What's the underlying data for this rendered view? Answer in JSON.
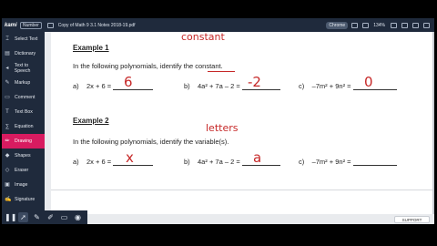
{
  "topbar": {
    "logo": "kami",
    "badge": "Number",
    "file_name": "Copy of Math 9 3.1 Notes 2018-19.pdf",
    "pill1": "Chrome",
    "zoom": "134%"
  },
  "sidebar": {
    "items": [
      {
        "label": "Select Text",
        "icon": "cursor-text-icon",
        "glyph": "⌶"
      },
      {
        "label": "Dictionary",
        "icon": "book-icon",
        "glyph": "▤"
      },
      {
        "label": "Text to Speech",
        "icon": "speaker-icon",
        "glyph": "◂"
      },
      {
        "label": "Markup",
        "icon": "highlighter-icon",
        "glyph": "✎"
      },
      {
        "label": "Comment",
        "icon": "comment-icon",
        "glyph": "▭"
      },
      {
        "label": "Text Box",
        "icon": "textbox-icon",
        "glyph": "T"
      },
      {
        "label": "Equation",
        "icon": "equation-icon",
        "glyph": "∑"
      },
      {
        "label": "Drawing",
        "icon": "pen-icon",
        "glyph": "✏"
      },
      {
        "label": "Shapes",
        "icon": "shapes-icon",
        "glyph": "◆"
      },
      {
        "label": "Eraser",
        "icon": "eraser-icon",
        "glyph": "◇"
      },
      {
        "label": "Image",
        "icon": "image-icon",
        "glyph": "▣"
      },
      {
        "label": "Signature",
        "icon": "signature-icon",
        "glyph": "✍"
      }
    ],
    "active_index": 7
  },
  "document": {
    "example1": {
      "title": "Example 1",
      "instruction": "In the following polynomials, identify the constant.",
      "annotation": "constant",
      "problems": [
        {
          "letter": "a)",
          "expr": "2x + 6  =",
          "answer": "6"
        },
        {
          "letter": "b)",
          "expr": "4a² + 7a – 2 =",
          "answer": "-2"
        },
        {
          "letter": "c)",
          "expr": "–7m² + 9n² =",
          "answer": "0"
        }
      ]
    },
    "example2": {
      "title": "Example 2",
      "instruction": "In the following polynomials, identify the variable(s).",
      "annotation": "letters",
      "problems": [
        {
          "letter": "a)",
          "expr": "2x + 6 =",
          "answer": "x"
        },
        {
          "letter": "b)",
          "expr": "4a² + 7a – 2 =",
          "answer": "a"
        },
        {
          "letter": "c)",
          "expr": "–7m² + 9n² =",
          "answer": ""
        }
      ]
    }
  },
  "bottom": {
    "support_label": "SUPPORT",
    "tools": [
      {
        "name": "pause-icon",
        "glyph": "❚❚"
      },
      {
        "name": "pointer-icon",
        "glyph": "➚"
      },
      {
        "name": "pen-icon",
        "glyph": "✎"
      },
      {
        "name": "marker-icon",
        "glyph": "✐"
      },
      {
        "name": "eraser-icon",
        "glyph": "▭"
      },
      {
        "name": "camera-icon",
        "glyph": "◉"
      }
    ]
  },
  "colors": {
    "ink": "#c62828",
    "sidebar": "#1f2a3c",
    "active": "#d81b60"
  }
}
